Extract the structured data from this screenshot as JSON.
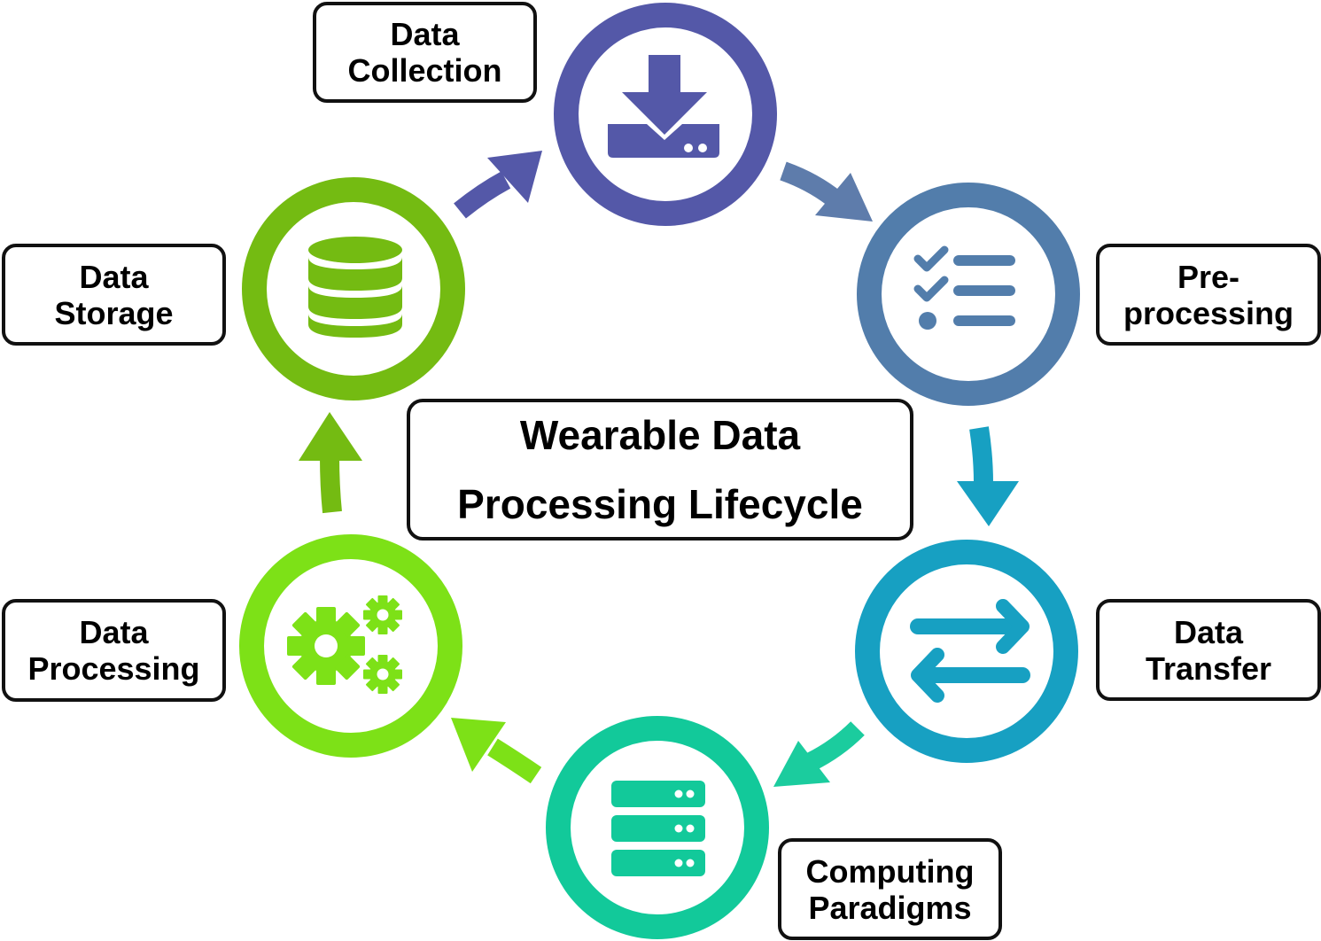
{
  "title": {
    "line1": "Wearable Data",
    "line2": "Processing Lifecycle"
  },
  "stages": [
    {
      "id": "data-collection",
      "line1": "Data",
      "line2": "Collection",
      "color": "#5458A8",
      "icon": "download-tray-icon"
    },
    {
      "id": "pre-processing",
      "line1": "Pre-",
      "line2": "processing",
      "color": "#527DAB",
      "icon": "checklist-icon"
    },
    {
      "id": "data-transfer",
      "line1": "Data",
      "line2": "Transfer",
      "color": "#17A0C2",
      "icon": "transfer-arrows-icon"
    },
    {
      "id": "computing-paradigms",
      "line1": "Computing",
      "line2": "Paradigms",
      "color": "#12C99A",
      "icon": "server-stack-icon"
    },
    {
      "id": "data-processing",
      "line1": "Data",
      "line2": "Processing",
      "color": "#7DE117",
      "icon": "gears-icon"
    },
    {
      "id": "data-storage",
      "line1": "Data",
      "line2": "Storage",
      "color": "#74BB12",
      "icon": "database-icon"
    }
  ],
  "arrows": [
    {
      "id": "arrow-collection-to-preprocessing",
      "color": "#5E7CAB"
    },
    {
      "id": "arrow-preprocessing-to-transfer",
      "color": "#17A0C2"
    },
    {
      "id": "arrow-transfer-to-computing",
      "color": "#1BCC9E"
    },
    {
      "id": "arrow-computing-to-processing",
      "color": "#7DE117"
    },
    {
      "id": "arrow-processing-to-storage",
      "color": "#74BB12"
    },
    {
      "id": "arrow-storage-to-collection",
      "color": "#5458A8"
    }
  ]
}
